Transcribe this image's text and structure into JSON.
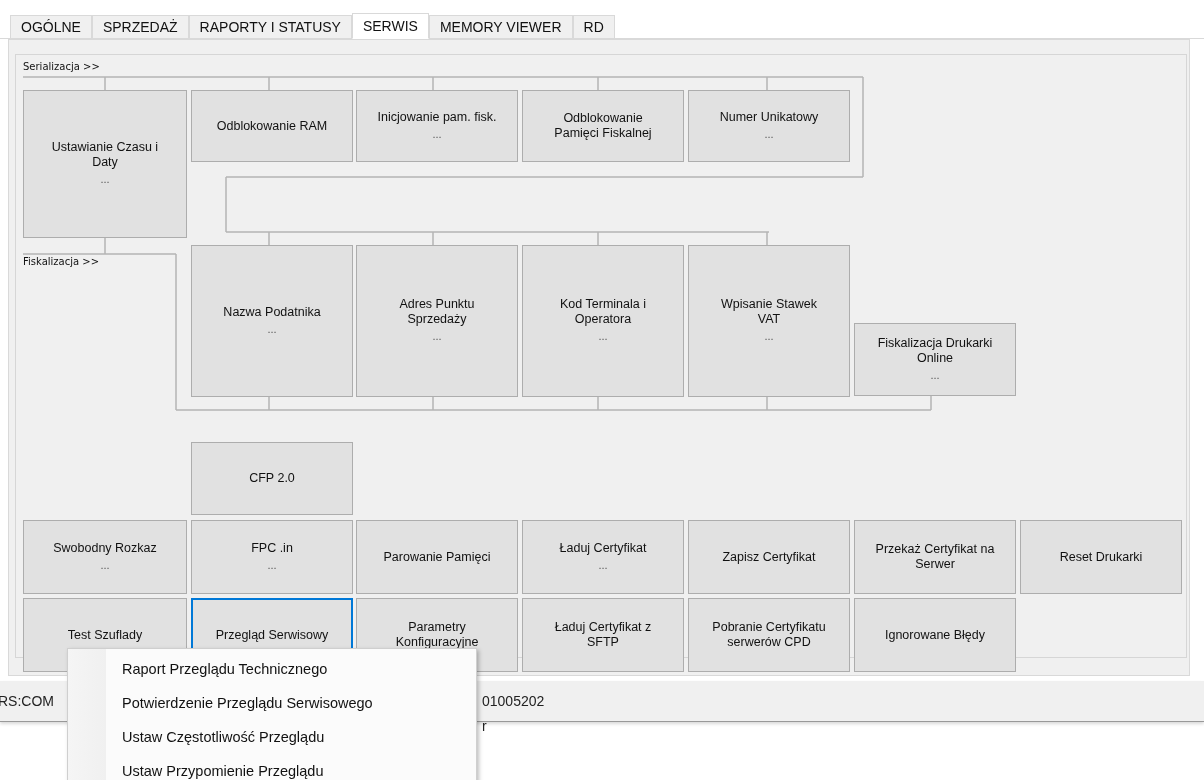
{
  "tabs": [
    {
      "label": "OGÓLNE",
      "selected": false
    },
    {
      "label": "SPRZEDAŻ",
      "selected": false
    },
    {
      "label": "RAPORTY I STATUSY",
      "selected": false
    },
    {
      "label": "SERWIS",
      "selected": true
    },
    {
      "label": "MEMORY VIEWER",
      "selected": false
    },
    {
      "label": "RD",
      "selected": false
    }
  ],
  "serializacja": {
    "label": "Serializacja >>",
    "buttons": [
      {
        "label": "Ustawianie Czasu i Daty",
        "more": "...",
        "focused": false
      },
      {
        "label": "Odblokowanie RAM",
        "focused": false
      },
      {
        "label": "Inicjowanie pam. fisk.",
        "more": "...",
        "focused": false
      },
      {
        "label": "Odblokowanie Pamięci Fiskalnej",
        "focused": false
      },
      {
        "label": "Numer Unikatowy",
        "more": "...",
        "focused": false
      }
    ]
  },
  "fiskalizacja": {
    "label": "Fiskalizacja >>",
    "buttons": [
      {
        "label": "Nazwa Podatnika",
        "more": "...",
        "focused": false
      },
      {
        "label": "Adres Punktu Sprzedaży",
        "more": "...",
        "focused": false
      },
      {
        "label": "Kod Terminala i Operatora",
        "more": "...",
        "focused": false
      },
      {
        "label": "Wpisanie Stawek VAT",
        "more": "...",
        "focused": false
      },
      {
        "label": "Fiskalizacja Drukarki Online",
        "more": "...",
        "focused": false
      }
    ]
  },
  "tools": [
    {
      "label": "CFP 2.0",
      "focused": false
    },
    {
      "label": "Swobodny Rozkaz",
      "more": "...",
      "focused": false
    },
    {
      "label": "FPC .in",
      "more": "...",
      "focused": false
    },
    {
      "label": "Parowanie Pamięci",
      "focused": false
    },
    {
      "label": "Ładuj Certyfikat",
      "more": "...",
      "focused": false
    },
    {
      "label": "Zapisz Certyfikat",
      "focused": false
    },
    {
      "label": "Przekaż Certyfikat na Serwer",
      "focused": false
    },
    {
      "label": "Reset Drukarki",
      "focused": false
    },
    {
      "label": "Test Szuflady",
      "focused": false
    },
    {
      "label": "Przegląd Serwisowy",
      "focused": true
    },
    {
      "label": "Parametry Konfiguracyjne",
      "focused": false
    },
    {
      "label": "Ładuj Certyfikat z SFTP",
      "focused": false
    },
    {
      "label": "Pobranie Certyfikatu serwerów CPD",
      "focused": false
    },
    {
      "label": "Ignorowane Błędy",
      "focused": false
    }
  ],
  "status_bar": {
    "port": "RS:COM",
    "serial": "01005202"
  },
  "below_text": "r",
  "context_menu": [
    "Raport Przeglądu Technicznego",
    "Potwierdzenie Przeglądu Serwisowego",
    "Ustaw Częstotliwość Przeglądu",
    "Ustaw Przypomienie Przeglądu"
  ]
}
